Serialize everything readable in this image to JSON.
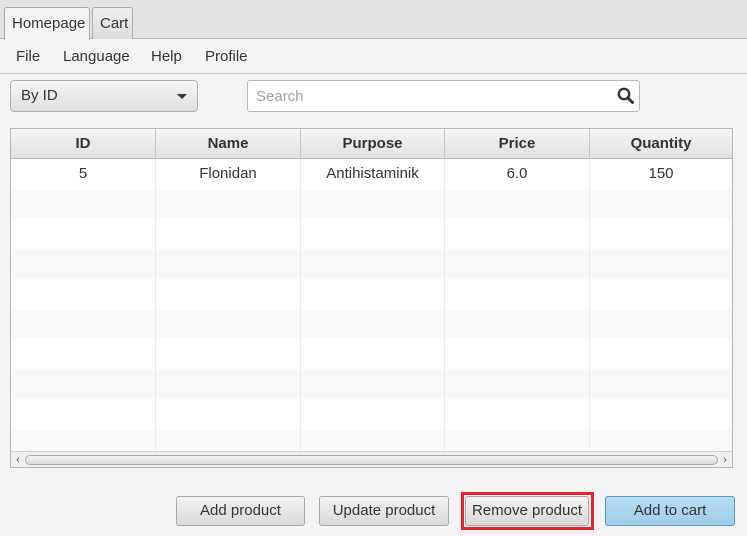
{
  "tabs": [
    {
      "label": "Homepage",
      "active": true
    },
    {
      "label": "Cart",
      "active": false
    }
  ],
  "menu": [
    "File",
    "Language",
    "Help",
    "Profile"
  ],
  "filter": {
    "selected": "By ID"
  },
  "search": {
    "placeholder": "Search",
    "value": ""
  },
  "table": {
    "columns": [
      "ID",
      "Name",
      "Purpose",
      "Price",
      "Quantity"
    ],
    "rows": [
      [
        "5",
        "Flonidan",
        "Antihistaminik",
        "6.0",
        "150"
      ]
    ]
  },
  "buttons": {
    "add_product": "Add product",
    "update_product": "Update product",
    "remove_product": "Remove product",
    "add_to_cart": "Add to cart"
  },
  "colors": {
    "highlight": "#e8212d",
    "default_button": "#9fcdea"
  }
}
